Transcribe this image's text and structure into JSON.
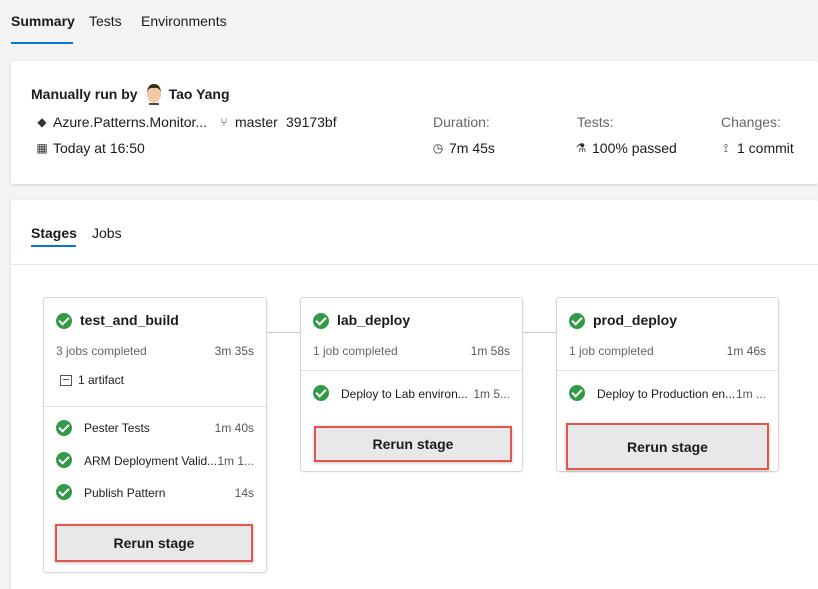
{
  "tabs": [
    "Summary",
    "Tests",
    "Environments"
  ],
  "summary": {
    "run_prefix": "Manually run by",
    "user": "Tao Yang",
    "repo": "Azure.Patterns.Monitor...",
    "branch": "master",
    "commit": "39173bf",
    "time": "Today at 16:50",
    "duration_label": "Duration:",
    "duration": "7m 45s",
    "tests_label": "Tests:",
    "tests": "100% passed",
    "changes_label": "Changes:",
    "changes": "1 commit"
  },
  "stage_tabs": [
    "Stages",
    "Jobs"
  ],
  "stages": [
    {
      "name": "test_and_build",
      "jobs_summary": "3 jobs completed",
      "duration": "3m 35s",
      "artifact": "1 artifact",
      "jobs": [
        {
          "name": "Pester Tests",
          "time": "1m 40s"
        },
        {
          "name": "ARM Deployment Valid...",
          "time": "1m 1..."
        },
        {
          "name": "Publish Pattern",
          "time": "14s"
        }
      ],
      "rerun": "Rerun stage"
    },
    {
      "name": "lab_deploy",
      "jobs_summary": "1 job completed",
      "duration": "1m 58s",
      "jobs": [
        {
          "name": "Deploy to Lab environ...",
          "time": "1m 5..."
        }
      ],
      "rerun": "Rerun stage"
    },
    {
      "name": "prod_deploy",
      "jobs_summary": "1 job completed",
      "duration": "1m 46s",
      "jobs": [
        {
          "name": "Deploy to Production en...",
          "time": "1m ..."
        }
      ],
      "rerun": "Rerun stage"
    }
  ],
  "colors": {
    "success": "#339947",
    "accent": "#0078d4",
    "highlight": "#e2554f"
  }
}
